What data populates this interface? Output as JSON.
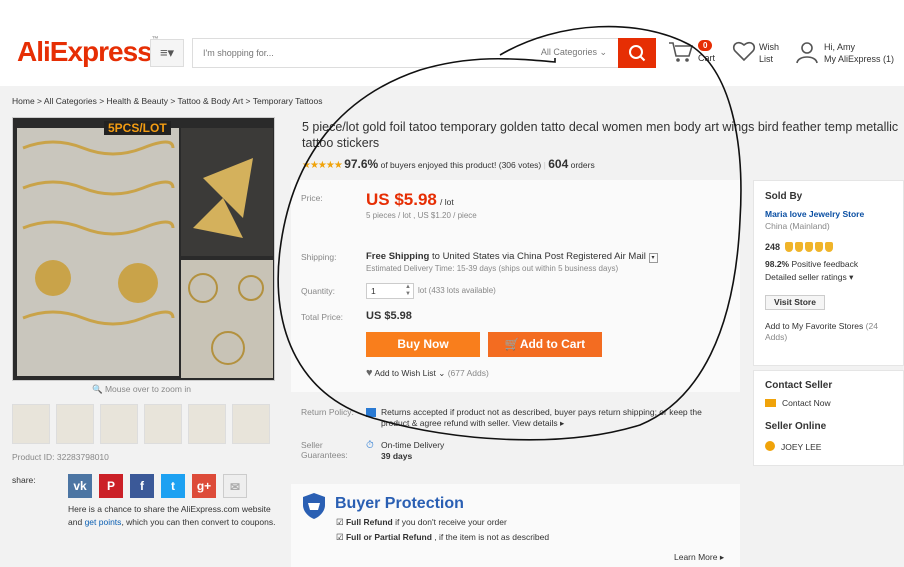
{
  "header": {
    "logo": "AliExpress",
    "search_placeholder": "I'm shopping for...",
    "category_select": "All Categories",
    "cart_count": "0",
    "cart_label": "Cart",
    "wish_line1": "Wish",
    "wish_line2": "List",
    "account_line1": "Hi, Amy",
    "account_line2": "My AliExpress",
    "account_count": "(1)"
  },
  "breadcrumb": [
    "Home",
    "All Categories",
    "Health & Beauty",
    "Tattoo & Body Art",
    "Temporary Tattoos"
  ],
  "gallery": {
    "image_tag": "5PCS/LOT",
    "zoom_hint": "Mouse over to zoom in",
    "thumbnail_count": 6,
    "product_id": "Product ID: 32283798010"
  },
  "share": {
    "label": "share:",
    "icons": [
      "vk-icon",
      "pinterest-icon",
      "facebook-icon",
      "twitter-icon",
      "googleplus-icon",
      "email-icon"
    ],
    "text_before": "Here is a chance to share the AliExpress.com website and",
    "link": "get points",
    "text_after": ", which you can then convert to coupons."
  },
  "product": {
    "title": "5 piece/lot gold foil tatoo temporary golden tatto decal women men body art wings bird feather temp metallic tattoo stickers",
    "stars": "★★★★★",
    "rating_percent": "97.6%",
    "rating_text": "of buyers enjoyed this product! (306 votes)",
    "orders_count": "604",
    "orders_label": "orders"
  },
  "purchase": {
    "price_label": "Price:",
    "price": "US $5.98",
    "price_unit": "/ lot",
    "price_sub": "5 pieces / lot , US $1.20 / piece",
    "shipping_label": "Shipping:",
    "shipping_free": "Free Shipping",
    "shipping_to": "to",
    "shipping_dest": "United States via China Post Registered Air Mail",
    "delivery_time": "Estimated Delivery Time: 15-39 days (ships out within 5 business days)",
    "quantity_label": "Quantity:",
    "quantity_value": "1",
    "quantity_avail": "lot (433 lots available)",
    "total_label": "Total Price:",
    "total": "US $5.98",
    "buy_now": "Buy Now",
    "add_to_cart": "Add to Cart",
    "wishlist": "Add to Wish List",
    "wishlist_adds": "(677 Adds)"
  },
  "policies": {
    "return_label": "Return Policy:",
    "return_text": "Returns accepted if product not as described, buyer pays return shipping; or keep the product & agree refund with seller.",
    "return_link": "View details",
    "guarantee_label": "Seller Guarantees:",
    "guarantee_title": "On-time Delivery",
    "guarantee_days": "39 days"
  },
  "buyer_protection": {
    "title": "Buyer Protection",
    "item1_bold": "Full Refund",
    "item1_rest": "if you don't receive your order",
    "item2_bold": "Full or Partial Refund",
    "item2_rest": ", if the item is not as described",
    "learn_more": "Learn More"
  },
  "seller": {
    "heading": "Sold By",
    "store_name": "Maria love Jewelry Store",
    "location": "China (Mainland)",
    "score": "248",
    "positive_pct": "98.2%",
    "positive_text": "Positive feedback",
    "detailed_ratings": "Detailed seller ratings",
    "visit_store": "Visit Store",
    "favorite": "Add to My Favorite Stores",
    "favorite_adds": "(24 Adds)"
  },
  "contact": {
    "heading": "Contact Seller",
    "contact_now": "Contact Now",
    "online_heading": "Seller Online",
    "online_name": "JOEY LEE"
  },
  "colors": {
    "brand": "#e62e04",
    "buy_now": "#f97e1c",
    "add_to_cart": "#f36c21",
    "link": "#0a4fa3",
    "protection": "#2a5fb3"
  }
}
